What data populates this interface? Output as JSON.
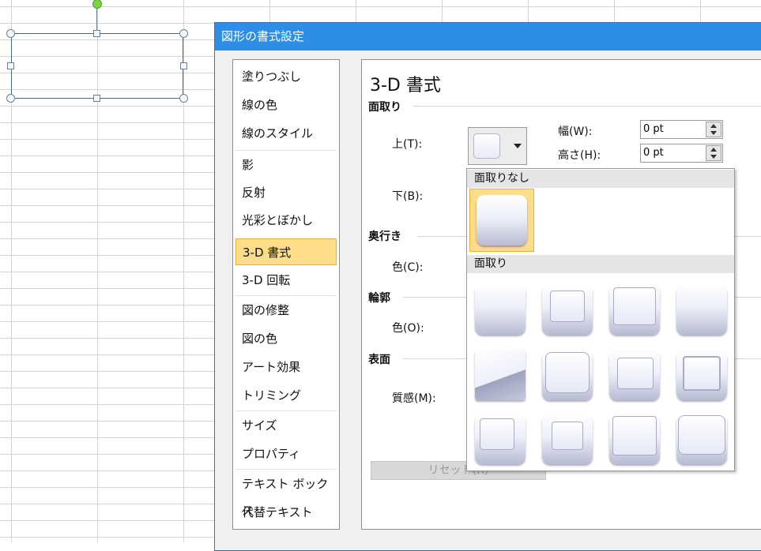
{
  "dialog": {
    "title": "図形の書式設定",
    "nav": [
      {
        "label": "塗りつぶし"
      },
      {
        "label": "線の色"
      },
      {
        "label": "線のスタイル"
      },
      {
        "label": "影"
      },
      {
        "label": "反射"
      },
      {
        "label": "光彩とぼかし"
      },
      {
        "label": "3-D 書式",
        "selected": true
      },
      {
        "label": "3-D 回転"
      },
      {
        "label": "図の修整"
      },
      {
        "label": "図の色"
      },
      {
        "label": "アート効果"
      },
      {
        "label": "トリミング"
      },
      {
        "label": "サイズ"
      },
      {
        "label": "プロパティ"
      },
      {
        "label": "テキスト ボックス"
      },
      {
        "label": "代替テキスト"
      }
    ]
  },
  "panel": {
    "title": "3-D 書式",
    "groups": {
      "bevel": "面取り",
      "depth": "奥行き",
      "contour": "輪郭",
      "surface": "表面"
    },
    "labels": {
      "top": "上(T):",
      "bottom": "下(B):",
      "width": "幅(W):",
      "height": "高さ(H):",
      "depth_color": "色(C):",
      "contour_color": "色(O):",
      "material": "質感(M):"
    },
    "width_value": "0 pt",
    "height_value": "0 pt",
    "reset_label": "リセット(R)"
  },
  "popup": {
    "no_bevel_header": "面取りなし",
    "bevel_header": "面取り"
  },
  "colors": {
    "accent": "#2e8ee5",
    "selection": "#fddc8a",
    "selection_border": "#f2b12c"
  },
  "icons": [
    "dropdown-arrow-icon",
    "spin-up-icon",
    "spin-down-icon"
  ]
}
